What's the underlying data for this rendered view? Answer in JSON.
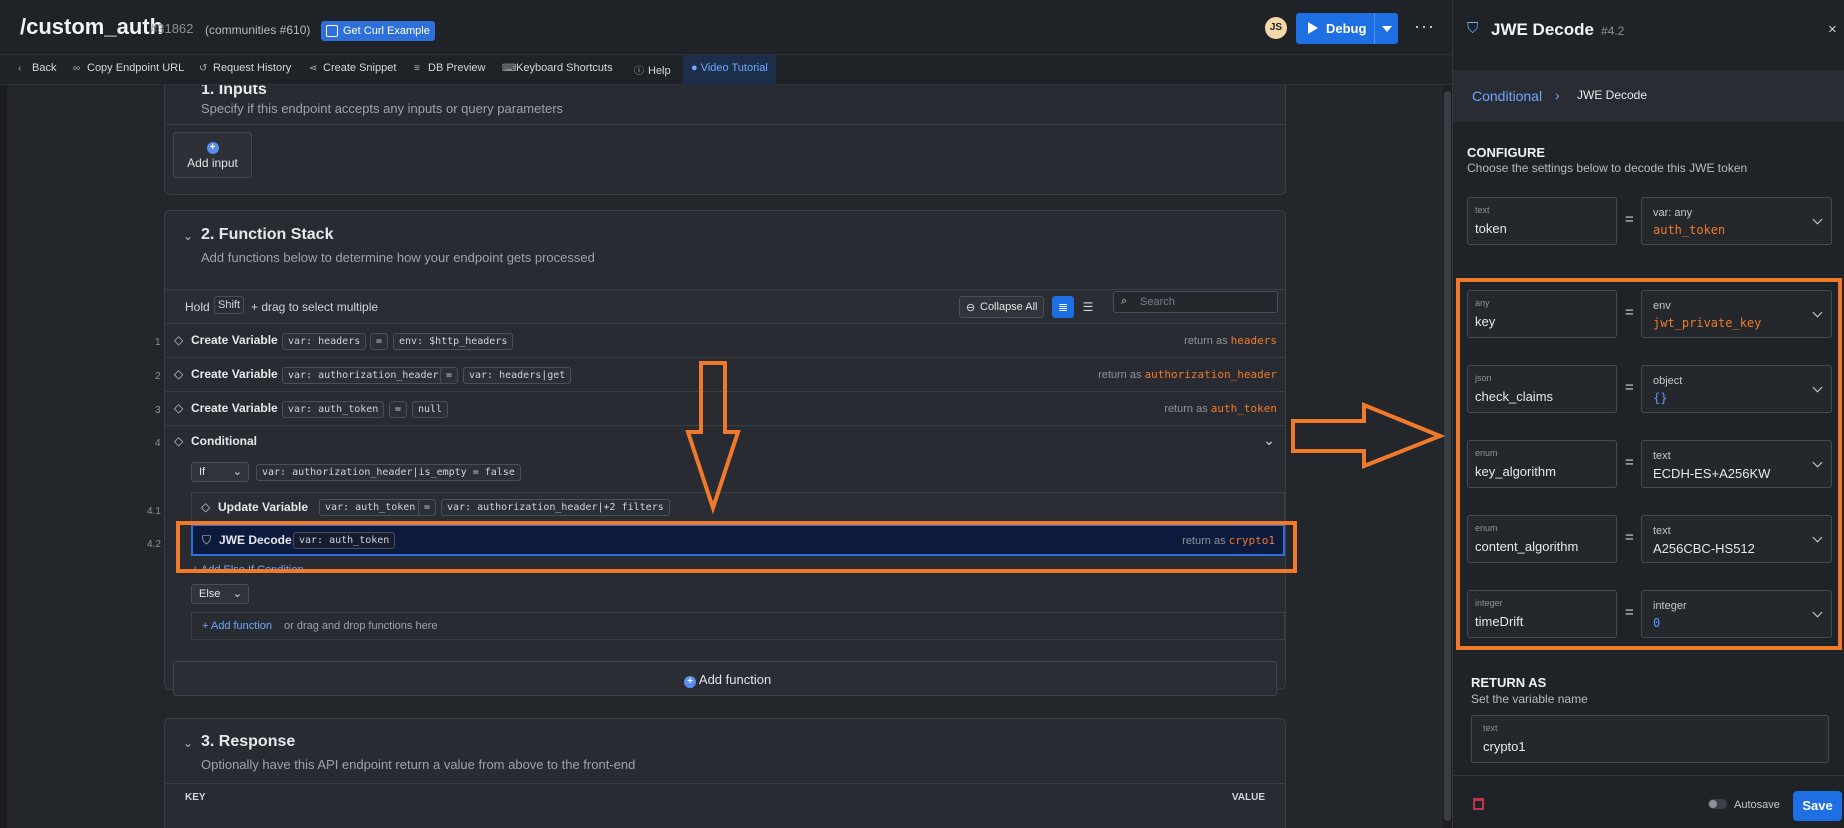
{
  "header": {
    "title": "/custom_auth",
    "id": "#31862",
    "community": "(communities #610)",
    "curl_button": "Get Curl Example",
    "avatar_initials": "JS",
    "debug_label": "Debug",
    "more": "···"
  },
  "toolbar": {
    "items": [
      "Back",
      "Copy Endpoint URL",
      "Request History",
      "Create Snippet",
      "DB Preview",
      "Keyboard Shortcuts",
      "Help"
    ],
    "video": "Video Tutorial"
  },
  "inputs": {
    "title": "1. Inputs",
    "subtitle": "Specify if this endpoint accepts any inputs or query parameters",
    "add_label": "Add input"
  },
  "function_stack": {
    "title": "2. Function Stack",
    "subtitle": "Add functions below to determine how your endpoint gets processed",
    "hold_label": "Hold",
    "shift_key": "Shift",
    "drag_hint": "+ drag to select multiple",
    "collapse_all": "Collapse All",
    "search_placeholder": "Search",
    "return_as": "return as",
    "rows": [
      {
        "num": "1",
        "name": "Create Variable",
        "pill_a": "var: headers",
        "eq": "=",
        "pill_b": "env: $http_headers",
        "ret": "headers"
      },
      {
        "num": "2",
        "name": "Create Variable",
        "pill_a": "var: authorization_header",
        "eq": "=",
        "pill_b": "var: headers|get",
        "ret": "authorization_header"
      },
      {
        "num": "3",
        "name": "Create Variable",
        "pill_a": "var: auth_token",
        "eq": "=",
        "pill_b": "null",
        "ret": "auth_token"
      }
    ],
    "conditional": {
      "num": "4",
      "name": "Conditional",
      "if_label": "If",
      "if_expr": "var: authorization_header|is_empty = false",
      "update": {
        "num": "4.1",
        "name": "Update Variable",
        "pill_a": "var: auth_token",
        "eq": "=",
        "pill_b": "var: authorization_header|+2 filters"
      },
      "jwe": {
        "num": "4.2",
        "name": "JWE Decode",
        "pill_a": "var: auth_token",
        "ret": "crypto1"
      },
      "add_else_if": "+ Add Else If Condition",
      "else_label": "Else",
      "add_function": "+ Add function",
      "drag_hint": "or drag and drop functions here"
    },
    "add_function_bottom": "Add function"
  },
  "response": {
    "title": "3. Response",
    "subtitle": "Optionally have this API endpoint return a value from above to the front-end",
    "key_header": "KEY",
    "value_header": "VALUE"
  },
  "panel": {
    "title": "JWE Decode",
    "id": "#4.2",
    "close": "×",
    "breadcrumb_parent": "Conditional",
    "breadcrumb_sep": "›",
    "breadcrumb_current": "JWE Decode",
    "configure_title": "CONFIGURE",
    "configure_sub": "Choose the settings below to decode this JWE token",
    "fields": [
      {
        "type": "text",
        "name": "token",
        "vtype": "var: any",
        "value": "auth_token",
        "style": "orange"
      },
      {
        "type": "any",
        "name": "key",
        "vtype": "env",
        "value": "jwt_private_key",
        "style": "orange"
      },
      {
        "type": "json",
        "name": "check_claims",
        "vtype": "object",
        "value": "{}",
        "style": "blue"
      },
      {
        "type": "enum",
        "name": "key_algorithm",
        "vtype": "text",
        "value": "ECDH-ES+A256KW",
        "style": "white"
      },
      {
        "type": "enum",
        "name": "content_algorithm",
        "vtype": "text",
        "value": "A256CBC-HS512",
        "style": "white"
      },
      {
        "type": "integer",
        "name": "timeDrift",
        "vtype": "integer",
        "value": "0",
        "style": "blue"
      }
    ],
    "return_title": "RETURN AS",
    "return_sub": "Set the variable name",
    "return_type": "text",
    "return_value": "crypto1",
    "autosave": "Autosave",
    "save": "Save"
  },
  "colors": {
    "accent": "#1d6fe3",
    "annotation": "#f07a2a",
    "highlight_bg": "#0b1a3d",
    "var_orange": "#f07a2a"
  }
}
